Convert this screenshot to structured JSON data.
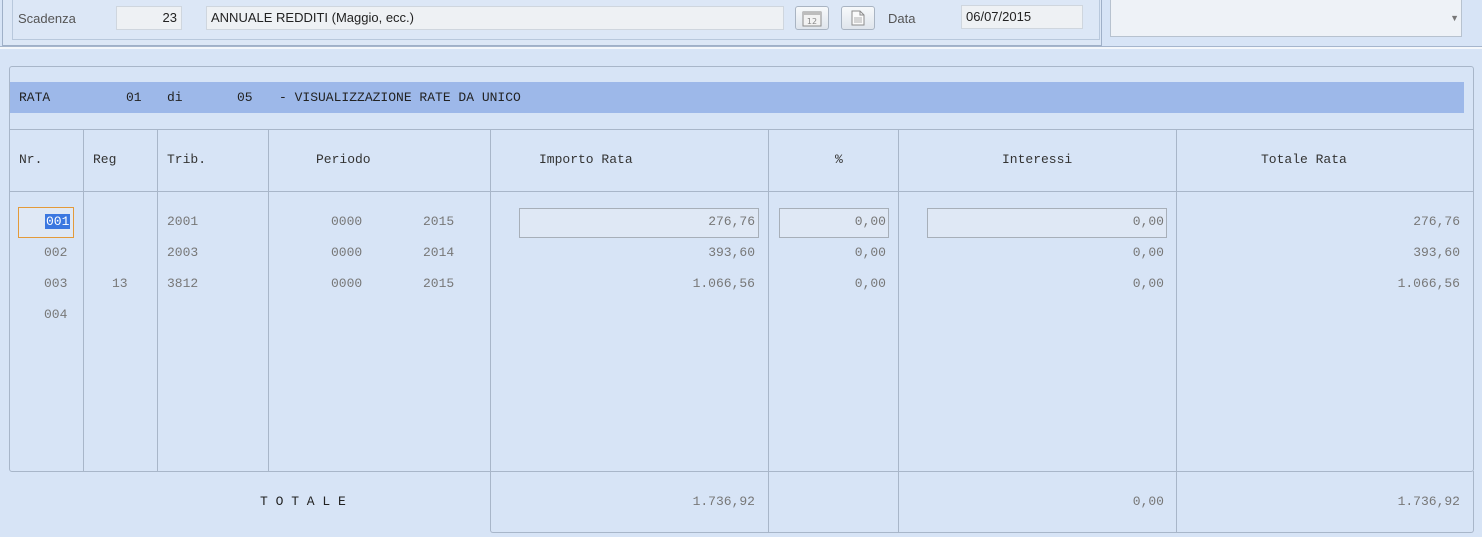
{
  "header": {
    "scadenza_label": "Scadenza",
    "scadenza_code": "23",
    "scadenza_desc": "ANNUALE REDDITI (Maggio, ecc.)",
    "data_label": "Data",
    "data_value": "06/07/2015",
    "calendar_icon": "calendar-icon",
    "document_icon": "document-icon"
  },
  "rata": {
    "label": "RATA",
    "number": "01",
    "of_label": "di",
    "total": "05",
    "description": "- VISUALIZZAZIONE RATE DA UNICO"
  },
  "table": {
    "columns": [
      "Nr.",
      "Reg",
      "Trib.",
      "Periodo",
      "Importo Rata",
      "%",
      "Interessi",
      "Totale Rata"
    ],
    "rows": [
      {
        "nr": "001",
        "reg": "",
        "trib": "2001",
        "periodo_a": "0000",
        "periodo_b": "2015",
        "importo": "276,76",
        "perc": "0,00",
        "interessi": "0,00",
        "totale": "276,76"
      },
      {
        "nr": "002",
        "reg": "",
        "trib": "2003",
        "periodo_a": "0000",
        "periodo_b": "2014",
        "importo": "393,60",
        "perc": "0,00",
        "interessi": "0,00",
        "totale": "393,60"
      },
      {
        "nr": "003",
        "reg": "13",
        "trib": "3812",
        "periodo_a": "0000",
        "periodo_b": "2015",
        "importo": "1.066,56",
        "perc": "0,00",
        "interessi": "0,00",
        "totale": "1.066,56"
      },
      {
        "nr": "004",
        "reg": "",
        "trib": "",
        "periodo_a": "",
        "periodo_b": "",
        "importo": "",
        "perc": "",
        "interessi": "",
        "totale": ""
      }
    ]
  },
  "totals": {
    "label": "T O T A L E",
    "importo": "1.736,92",
    "interessi": "0,00",
    "totale": "1.736,92"
  },
  "colors": {
    "background": "#d7e4f6",
    "rata_bar": "#9db8e9",
    "selection": "#3b77e0",
    "focus_border": "#e39a3a"
  }
}
